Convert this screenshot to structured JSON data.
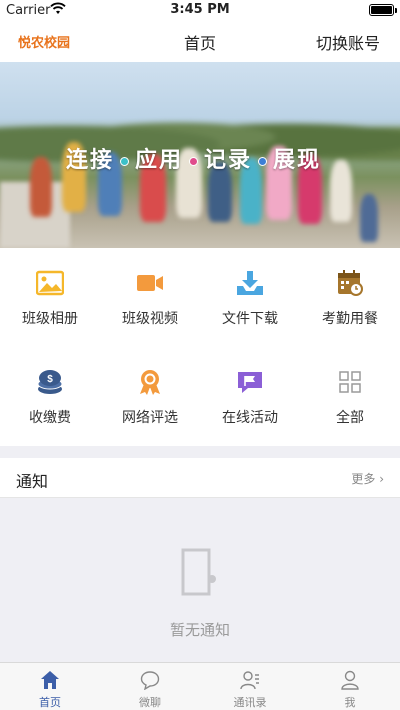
{
  "status_bar": {
    "carrier": "Carrier",
    "time": "3:45 PM"
  },
  "nav": {
    "logo": "悦农校园",
    "title": "首页",
    "switch_account": "切换账号"
  },
  "banner": {
    "words": [
      "连接",
      "应用",
      "记录",
      "展现"
    ],
    "dot_colors": [
      "#3cc0c8",
      "#e04c8c",
      "#3c7fd6"
    ]
  },
  "grid": {
    "items": [
      {
        "label": "班级相册",
        "icon": "photo-album-icon"
      },
      {
        "label": "班级视频",
        "icon": "video-camera-icon"
      },
      {
        "label": "文件下载",
        "icon": "download-tray-icon"
      },
      {
        "label": "考勤用餐",
        "icon": "calendar-clock-icon"
      },
      {
        "label": "收缴费",
        "icon": "coin-stack-icon"
      },
      {
        "label": "网络评选",
        "icon": "award-ribbon-icon"
      },
      {
        "label": "在线活动",
        "icon": "flag-chat-icon"
      },
      {
        "label": "全部",
        "icon": "grid-four-icon"
      }
    ]
  },
  "notice": {
    "title": "通知",
    "more": "更多 ›"
  },
  "empty": {
    "text": "暂无通知"
  },
  "tabs": [
    {
      "label": "首页",
      "icon": "home-icon",
      "active": true
    },
    {
      "label": "微聊",
      "icon": "chat-bubble-icon",
      "active": false
    },
    {
      "label": "通讯录",
      "icon": "contacts-icon",
      "active": false
    },
    {
      "label": "我",
      "icon": "person-icon",
      "active": false
    }
  ],
  "colors": {
    "accent": "#3c5ea8",
    "logo": "#e8731c",
    "icon_yellow": "#f5b72a",
    "icon_orange": "#f39a3d",
    "icon_blue": "#4aa6e0",
    "icon_navy": "#3a5a8c",
    "icon_purple": "#8b5fd6",
    "icon_gray": "#9a9a9a"
  }
}
